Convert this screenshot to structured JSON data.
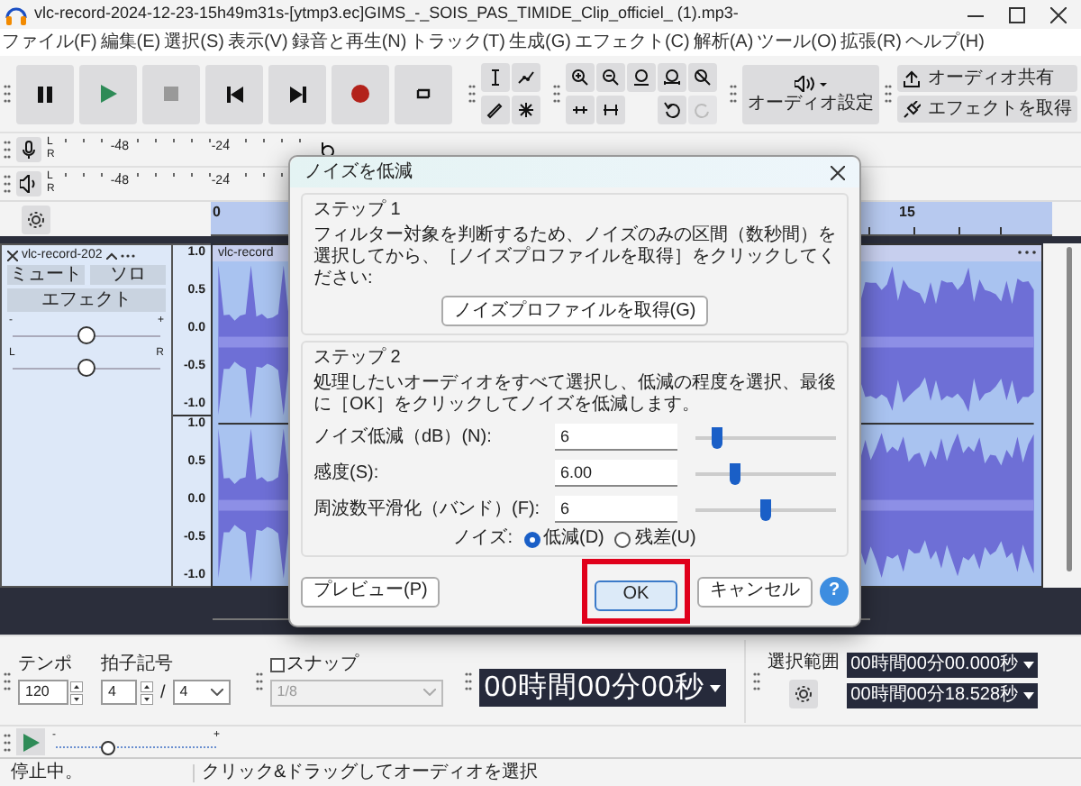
{
  "window": {
    "title": "vlc-record-2024-12-23-15h49m31s-[ytmp3.ec]GIMS_-_SOIS_PAS_TIMIDE_Clip_officiel_ (1).mp3-"
  },
  "menu": [
    "ファイル(F)",
    "編集(E)",
    "選択(S)",
    "表示(V)",
    "録音と再生(N)",
    "トラック(T)",
    "生成(G)",
    "エフェクト(C)",
    "解析(A)",
    "ツール(O)",
    "拡張(R)",
    "ヘルプ(H)"
  ],
  "toolbar": {
    "audio_setup": "オーディオ設定",
    "share": "オーディオ共有",
    "get_effects": "エフェクトを取得"
  },
  "record_meter": {
    "channels": [
      "L",
      "R"
    ],
    "ticks": [
      "-48",
      "-24"
    ]
  },
  "playback_meter": {
    "channels": [
      "L",
      "R"
    ],
    "ticks": [
      "-48",
      "-24"
    ]
  },
  "ruler": [
    "0",
    "15"
  ],
  "track": {
    "name": "vlc-record-202",
    "mute": "ミュート",
    "solo": "ソロ",
    "effects": "エフェクト",
    "gain": {
      "min": "-",
      "max": "+",
      "level": 0.5
    },
    "pan": {
      "min": "L",
      "max": "R",
      "level": 0.5
    },
    "clip_name": "vlc-record",
    "scales": [
      [
        "1.0",
        "0.5",
        "0.0",
        "-0.5",
        "-1.0"
      ],
      [
        "1.0",
        "0.5",
        "0.0",
        "-0.5",
        "-1.0"
      ]
    ]
  },
  "dialog": {
    "title": "ノイズを低減",
    "step1": {
      "heading": "ステップ 1",
      "text": "フィルター対象を判断するため、ノイズのみの区間（数秒間）を選択してから、［ノイズプロファイルを取得］をクリックしてください:",
      "button": "ノイズプロファイルを取得(G)"
    },
    "step2": {
      "heading": "ステップ 2",
      "text": "処理したいオーディオをすべて選択し、低減の程度を選択、最後に［OK］をクリックしてノイズを低減します。",
      "params": [
        {
          "label": "ノイズ低減（dB）(N):",
          "value": "6",
          "level": 0.16
        },
        {
          "label": "感度(S):",
          "value": "6.00",
          "level": 0.28
        },
        {
          "label": "周波数平滑化（バンド）(F):",
          "value": "6",
          "level": 0.5
        }
      ],
      "noise_label": "ノイズ:",
      "noise_options": [
        {
          "label": "低減(D)",
          "selected": true
        },
        {
          "label": "残差(U)",
          "selected": false
        }
      ]
    },
    "buttons": [
      {
        "kind": "preview",
        "label": "プレビュー(P)",
        "highlighted": false
      },
      {
        "kind": "ok",
        "label": "OK",
        "highlighted": true
      },
      {
        "kind": "cancel",
        "label": "キャンセル",
        "highlighted": false
      },
      {
        "kind": "help",
        "label": "?",
        "highlighted": false
      }
    ]
  },
  "tempo": {
    "label": "テンポ",
    "value": "120"
  },
  "time_signature": {
    "label": "拍子記号",
    "upper": "4",
    "separator": "/",
    "lower": "4"
  },
  "snap": {
    "label": "スナップ",
    "checked": false,
    "value": "1/8"
  },
  "time_display": "00時間00分00秒",
  "selection": {
    "label": "選択範囲",
    "start": "00時間00分00.000秒",
    "end": "00時間00分18.528秒"
  },
  "play_speed": {
    "min": "-",
    "max": "+",
    "level": 0.33
  },
  "status": [
    "停止中。",
    "クリック&ドラッグしてオーディオを選択"
  ]
}
